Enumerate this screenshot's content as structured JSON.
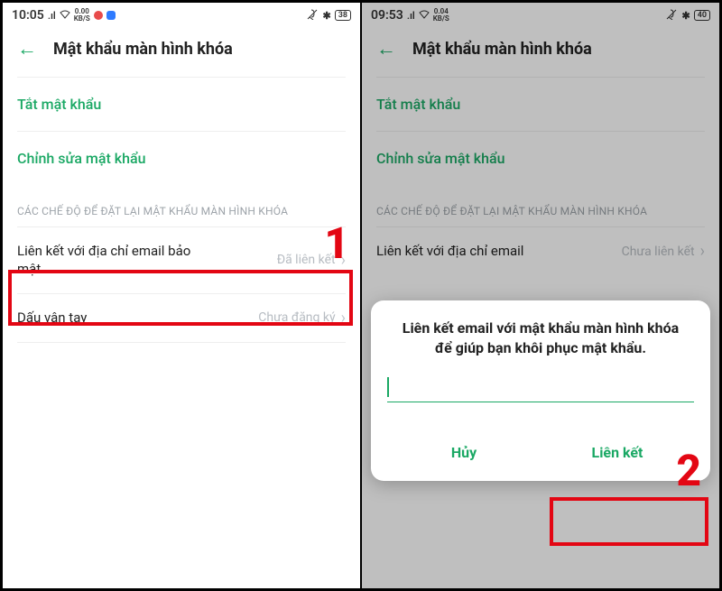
{
  "left": {
    "status": {
      "time": "10:05",
      "kbps_top": "0.00",
      "kbps_bot": "KB/S",
      "battery": "38"
    },
    "title": "Mật khẩu màn hình khóa",
    "options": {
      "disable": "Tắt mật khẩu",
      "edit": "Chỉnh sửa mật khẩu"
    },
    "section": "CÁC CHẾ ĐỘ ĐỂ ĐẶT LẠI MẬT KHẨU MÀN HÌNH KHÓA",
    "rows": {
      "email": {
        "label": "Liên kết với địa chỉ email bảo mật",
        "status": "Đã liên kết"
      },
      "fingerprint": {
        "label": "Dấu vân tay",
        "status": "Chưa đăng ký"
      }
    },
    "callout": "1"
  },
  "right": {
    "status": {
      "time": "09:53",
      "kbps_top": "0.04",
      "kbps_bot": "KB/S",
      "battery": "40"
    },
    "title": "Mật khẩu màn hình khóa",
    "options": {
      "disable": "Tắt mật khẩu",
      "edit": "Chỉnh sửa mật khẩu"
    },
    "section": "CÁC CHẾ ĐỘ ĐỂ ĐẶT LẠI MẬT KHẨU MÀN HÌNH KHÓA",
    "rows": {
      "email": {
        "label": "Liên kết với địa chỉ email",
        "status": "Chưa liên kết"
      }
    },
    "dialog": {
      "title": "Liên kết email với mật khẩu màn hình khóa để giúp bạn khôi phục mật khẩu.",
      "cancel": "Hủy",
      "confirm": "Liên kết"
    },
    "callout": "2"
  }
}
